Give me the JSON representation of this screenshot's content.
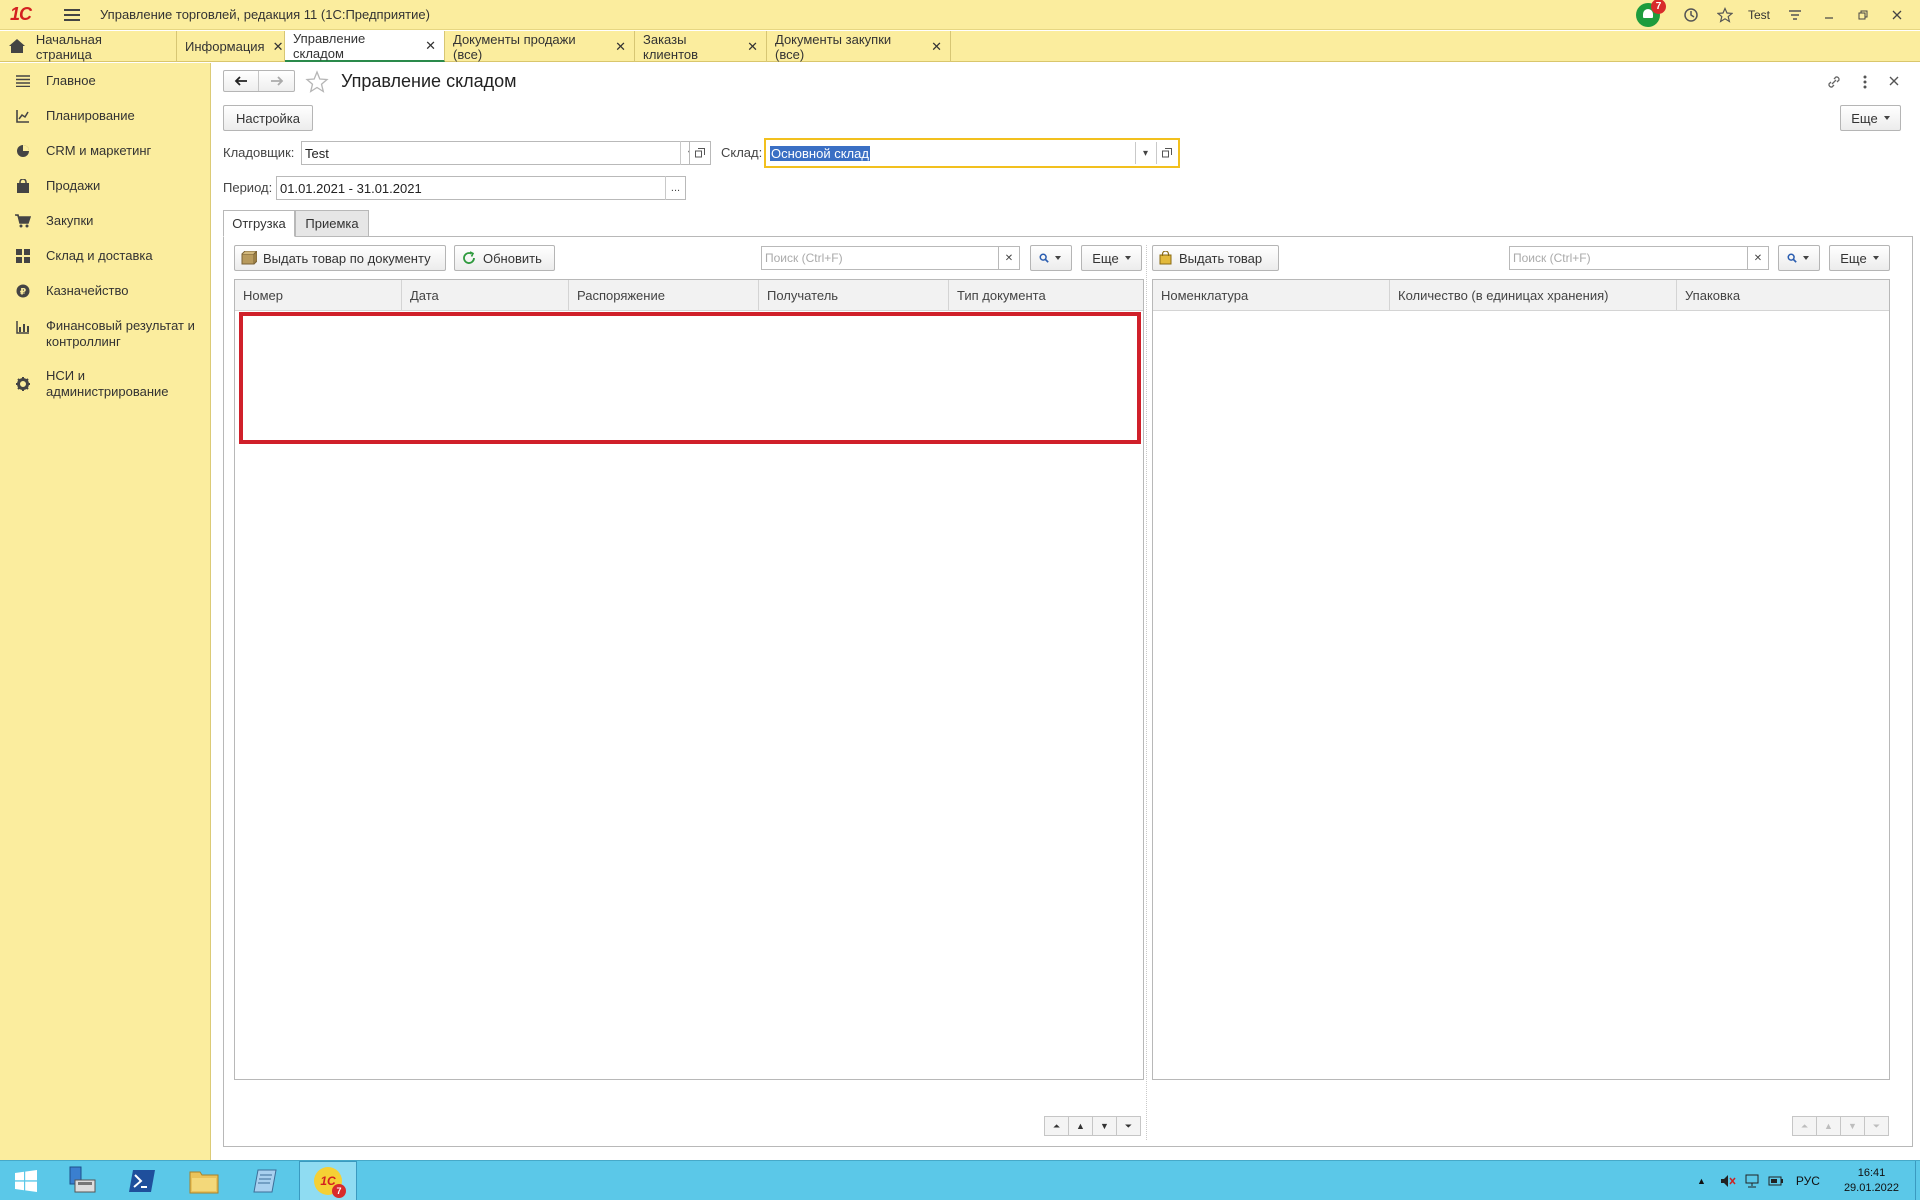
{
  "titlebar": {
    "app_title": "Управление торговлей, редакция 11  (1С:Предприятие)",
    "notification_count": "7",
    "user": "Test"
  },
  "tabs": [
    {
      "label": "Начальная страница"
    },
    {
      "label": "Информация"
    },
    {
      "label": "Управление складом"
    },
    {
      "label": "Документы продажи (все)"
    },
    {
      "label": "Заказы клиентов"
    },
    {
      "label": "Документы закупки (все)"
    }
  ],
  "sidebar": {
    "items": [
      {
        "label": "Главное",
        "icon": "list-icon"
      },
      {
        "label": "Планирование",
        "icon": "planning-icon"
      },
      {
        "label": "CRM и маркетинг",
        "icon": "pie-chart-icon"
      },
      {
        "label": "Продажи",
        "icon": "shopping-bag-icon"
      },
      {
        "label": "Закупки",
        "icon": "cart-icon"
      },
      {
        "label": "Склад и доставка",
        "icon": "grid-icon"
      },
      {
        "label": "Казначейство",
        "icon": "ruble-icon"
      },
      {
        "label": "Финансовый результат и контроллинг",
        "icon": "bar-chart-icon"
      },
      {
        "label": "НСИ и администрирование",
        "icon": "gear-icon"
      }
    ]
  },
  "form": {
    "title": "Управление складом",
    "settings_label": "Настройка",
    "more_label": "Еще",
    "storekeeper_label": "Кладовщик:",
    "storekeeper_value": "Test",
    "warehouse_label": "Склад:",
    "warehouse_value": "Основной склад",
    "period_label": "Период:",
    "period_value": "01.01.2021 - 31.01.2021",
    "period_button": "...",
    "subtabs": [
      "Отгрузка",
      "Приемка"
    ]
  },
  "left_panel": {
    "issue_by_doc_label": "Выдать товар по документу",
    "refresh_label": "Обновить",
    "search_placeholder": "Поиск (Ctrl+F)",
    "more_label": "Еще",
    "columns": [
      "Номер",
      "Дата",
      "Распоряжение",
      "Получатель",
      "Тип документа"
    ]
  },
  "right_panel": {
    "issue_label": "Выдать товар",
    "search_placeholder": "Поиск (Ctrl+F)",
    "more_label": "Еще",
    "columns": [
      "Номенклатура",
      "Количество (в единицах хранения)",
      "Упаковка"
    ]
  },
  "taskbar": {
    "lang": "РУС",
    "time": "16:41",
    "date": "29.01.2022",
    "badge": "7"
  },
  "colors": {
    "chrome_yellow": "#fbed9e",
    "active_tab_underline": "#2a8a4b",
    "highlight_red": "#d0202a",
    "focus_yellow": "#f2c01e",
    "selection_blue": "#3a6fc4",
    "taskbar": "#5bc8e8"
  }
}
